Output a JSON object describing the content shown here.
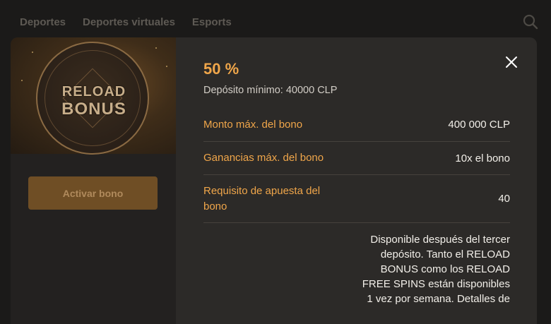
{
  "background": {
    "nav_items": [
      "Deportes",
      "Deportes virtuales",
      "Esports"
    ]
  },
  "modal": {
    "badge": {
      "line1": "RELOAD",
      "line2": "BONUS"
    },
    "activate_button": "Activar bono",
    "percent": "50 %",
    "min_deposit": "Depósito mínimo: 40000 CLP",
    "rows": [
      {
        "label": "Monto máx. del bono",
        "value": "400 000 CLP"
      },
      {
        "label": "Ganancias máx. del bono",
        "value": "10x el bono"
      },
      {
        "label": "Requisito de apuesta del bono",
        "value": "40"
      }
    ],
    "description": "Disponible después del tercer depósito. Tanto el RELOAD BONUS como los RELOAD FREE SPINS están disponibles 1 vez por semana. Detalles de"
  },
  "colors": {
    "accent": "#f0a64a",
    "modal_bg": "#2c2a28",
    "button_bg": "#6f4e25"
  },
  "icons": {
    "close": "close-icon",
    "search": "search-icon"
  }
}
